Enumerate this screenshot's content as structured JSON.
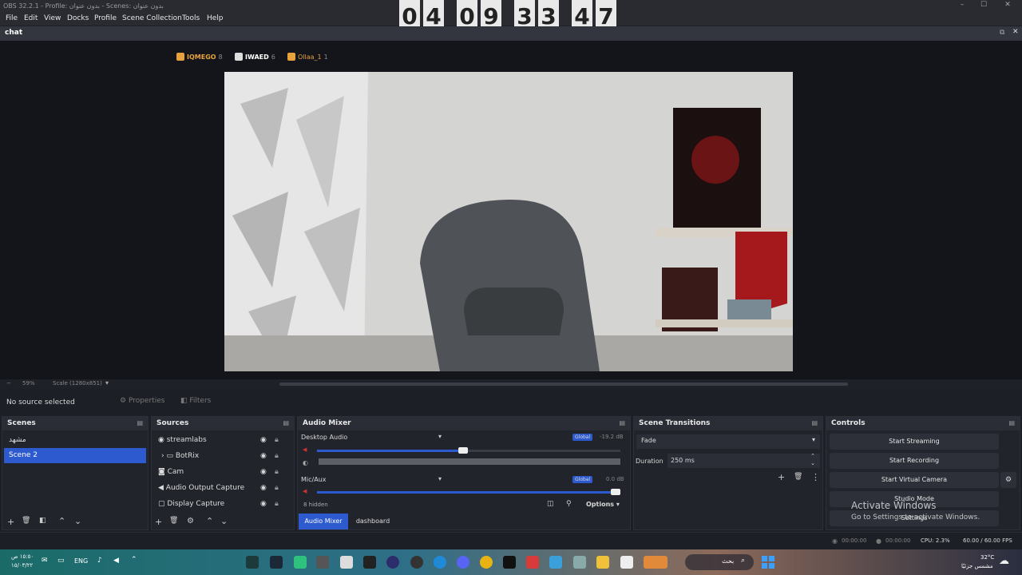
{
  "window": {
    "title": "OBS 32.2.1 - Profile: بدون عنوان - Scenes: بدون عنوان"
  },
  "menu": [
    "File",
    "Edit",
    "View",
    "Docks",
    "Profile",
    "Scene Collection",
    "Tools",
    "Help"
  ],
  "timer": {
    "digits": [
      "0",
      "4",
      "0",
      "9",
      "3",
      "3",
      "4",
      "7"
    ]
  },
  "chat": {
    "title": "chat",
    "users": [
      {
        "name": "IQMEGO",
        "count": "8",
        "color": "#e7a23b"
      },
      {
        "name": "IWAED",
        "count": "6",
        "color": "#ffffff"
      },
      {
        "name": "Ollaa_1",
        "count": "1",
        "color": "#e7a23b"
      }
    ]
  },
  "preview_toolbar": {
    "zoom": "59%",
    "scale": "Scale (1280x851)"
  },
  "source_bar": {
    "status": "No source selected",
    "properties": "Properties",
    "filters": "Filters"
  },
  "scenes": {
    "title": "Scenes",
    "items": [
      "مشهد",
      "Scene 2"
    ],
    "selected_index": 1
  },
  "sources": {
    "title": "Sources",
    "items": [
      {
        "name": "streamlabs",
        "icon": "globe-icon"
      },
      {
        "name": "BotRix",
        "icon": "folder-icon"
      },
      {
        "name": "Cam",
        "icon": "camera-icon"
      },
      {
        "name": "Audio Output Capture",
        "icon": "speaker-icon"
      },
      {
        "name": "Display Capture",
        "icon": "monitor-icon"
      }
    ]
  },
  "audio": {
    "title": "Audio Mixer",
    "channels": [
      {
        "name": "Desktop Audio",
        "tag": "Global",
        "db": "-19.2 dB",
        "level": 0.48
      },
      {
        "name": "Mic/Aux",
        "tag": "Global",
        "db": "0.0 dB",
        "level": 1.0
      }
    ],
    "hidden": "8 hidden",
    "options": "Options",
    "tabs": [
      "Audio Mixer",
      "dashboard"
    ]
  },
  "transitions": {
    "title": "Scene Transitions",
    "type": "Fade",
    "duration_label": "Duration",
    "duration": "250 ms"
  },
  "controls": {
    "title": "Controls",
    "buttons": [
      "Start Streaming",
      "Start Recording",
      "Start Virtual Camera",
      "Studio Mode",
      "Settings"
    ]
  },
  "watermark": {
    "title": "Activate Windows",
    "subtitle": "Go to Settings to activate Windows."
  },
  "status": {
    "time1": "00:00:00",
    "time2": "00:00:00",
    "cpu": "CPU: 2.3%",
    "fps": "60.00 / 60.00 FPS"
  },
  "taskbar": {
    "clock_line1": "١٥:٥٠ ص",
    "clock_line2": "١٥/٠٣/٢٢",
    "lang": "ENG",
    "search": "بحث",
    "weather_temp": "32°C",
    "weather_desc": "مشمس جزئيًا"
  }
}
